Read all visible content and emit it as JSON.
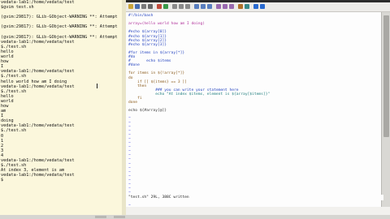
{
  "terminal": {
    "lines": [
      "vedata-lab1:/home/vedata/test",
      "$gvim test.sh",
      "",
      "(gvim:29817): GLib-GObject-WARNING **: Attempt",
      "",
      "(gvim:29817): GLib-GObject-WARNING **: Attempt",
      "",
      "(gvim:29817): GLib-GObject-WARNING **: Attempt",
      "vedata-lab1:/home/vedata/test",
      "$./test.sh",
      "hello",
      "world",
      "how",
      "I",
      "vedata-lab1:/home/vedata/test",
      "$./test.sh",
      "hello world how am I doing",
      "vedata-lab1:/home/vedata/test",
      "$./test.sh",
      "hello",
      "world",
      "how",
      "am",
      "I",
      "doing",
      "vedata-lab1:/home/vedata/test",
      "$./test.sh",
      "0",
      "1",
      "2",
      "3",
      "4",
      "vedata-lab1:/home/vedata/test",
      "$./test.sh",
      "At index 3, element is am",
      "vedata-lab1:/home/vedata/test",
      "$"
    ]
  },
  "editor": {
    "code": [
      {
        "t": "#!/bin/bash",
        "c": "c-blue"
      },
      {
        "t": "",
        "c": ""
      },
      {
        "t": "array=(hello world how am I doing)",
        "c": "c-mag"
      },
      {
        "t": "",
        "c": ""
      },
      {
        "t": "#echo ${array[0]}",
        "c": "c-blue"
      },
      {
        "t": "#echo ${array[1]}",
        "c": "c-blue"
      },
      {
        "t": "#echo ${array[2]}",
        "c": "c-blue"
      },
      {
        "t": "#echo ${array[3]}",
        "c": "c-blue"
      },
      {
        "t": "",
        "c": ""
      },
      {
        "t": "#for items in ${array[*]}",
        "c": "c-blue"
      },
      {
        "t": "#do",
        "c": "c-blue"
      },
      {
        "t": "#       echo $items",
        "c": "c-blue"
      },
      {
        "t": "#done",
        "c": "c-blue"
      },
      {
        "t": "",
        "c": ""
      },
      {
        "t": "for items in ${!array[*]}",
        "c": "c-brown"
      },
      {
        "t": "do",
        "c": "c-brown"
      },
      {
        "t": "    if [[ ${items} == 3 ]]",
        "c": "c-brown"
      },
      {
        "t": "    then",
        "c": "c-brown"
      },
      {
        "t": "            ### you can write your statement here",
        "c": "c-blue"
      },
      {
        "t": "            echo \"At index $items, element is ${array[$items]}\"",
        "c": "c-teal"
      },
      {
        "t": "    fi",
        "c": "c-brown"
      },
      {
        "t": "done",
        "c": "c-brown"
      },
      {
        "t": "",
        "c": ""
      },
      {
        "t": "echo ${#array[@]}",
        "c": "c-grey"
      }
    ],
    "status": "\"test.sh\" 29L, 388C written"
  }
}
